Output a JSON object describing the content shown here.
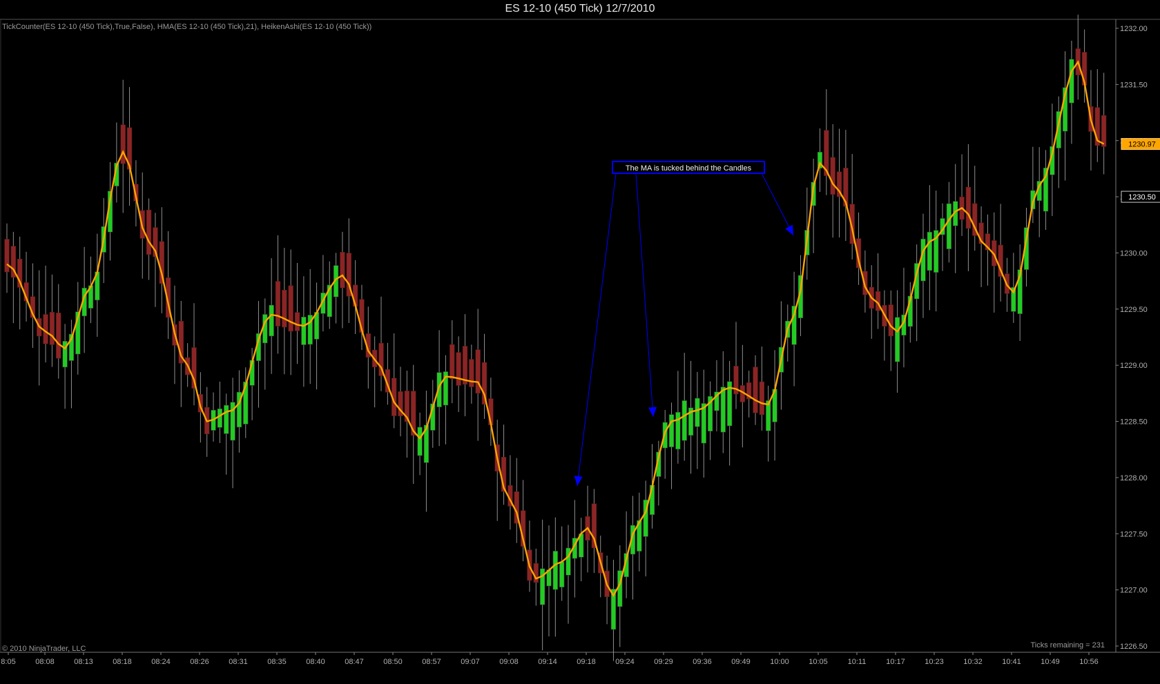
{
  "window": {
    "title": "ES 12-10 (450 Tick)  12/7/2010"
  },
  "chart": {
    "indicator_label": "TickCounter(ES 12-10 (450 Tick),True,False), HMA(ES 12-10 (450 Tick),21), HeikenAshi(ES 12-10 (450 Tick))",
    "copyright": "© 2010 NinjaTrader, LLC",
    "ticks_remaining": "Ticks remaining = 231",
    "annotation": "The MA is tucked behind the Candles",
    "price_markers": {
      "hma_value": "1230.97",
      "last_price": "1230.50"
    },
    "colors": {
      "up_candle": "#22cc22",
      "down_candle": "#8b2525",
      "hma": "#ffa500",
      "annotation_border": "#0000ff",
      "arrow": "#0000ff",
      "wick": "#909090"
    }
  },
  "chart_data": {
    "type": "candlestick",
    "instrument": "ES 12-10",
    "bar_type": "450 Tick",
    "date": "12/7/2010",
    "y_ticks": [
      "1232.00",
      "1231.50",
      "1231.00",
      "1230.50",
      "1230.00",
      "1229.50",
      "1229.00",
      "1228.50",
      "1228.00",
      "1227.50",
      "1227.00",
      "1226.50"
    ],
    "y_tick_values": [
      1232.0,
      1231.5,
      1231.0,
      1230.5,
      1230.0,
      1229.5,
      1229.0,
      1228.5,
      1228.0,
      1227.5,
      1227.0,
      1226.5
    ],
    "x_ticks": [
      "8:05",
      "08:08",
      "08:13",
      "08:18",
      "08:24",
      "08:26",
      "08:31",
      "08:35",
      "08:40",
      "08:47",
      "08:50",
      "08:57",
      "09:07",
      "09:08",
      "09:14",
      "09:18",
      "09:24",
      "09:29",
      "09:36",
      "09:49",
      "10:00",
      "10:05",
      "10:11",
      "10:17",
      "10:23",
      "10:32",
      "10:41",
      "10:49",
      "10:56"
    ],
    "ylim": [
      1226.5,
      1232.0
    ],
    "bars": 171,
    "hma_period": 21,
    "hma_anchors": [
      [
        0,
        1229.9
      ],
      [
        6,
        1229.3
      ],
      [
        9,
        1229.15
      ],
      [
        13,
        1229.7
      ],
      [
        18,
        1230.9
      ],
      [
        22,
        1230.1
      ],
      [
        28,
        1229.0
      ],
      [
        31,
        1228.5
      ],
      [
        35,
        1228.6
      ],
      [
        41,
        1229.45
      ],
      [
        46,
        1229.35
      ],
      [
        52,
        1229.8
      ],
      [
        57,
        1229.05
      ],
      [
        61,
        1228.6
      ],
      [
        64,
        1228.35
      ],
      [
        68,
        1228.9
      ],
      [
        73,
        1228.85
      ],
      [
        78,
        1227.8
      ],
      [
        82,
        1227.1
      ],
      [
        86,
        1227.25
      ],
      [
        90,
        1227.55
      ],
      [
        94,
        1226.95
      ],
      [
        98,
        1227.6
      ],
      [
        103,
        1228.5
      ],
      [
        107,
        1228.6
      ],
      [
        112,
        1228.8
      ],
      [
        118,
        1228.65
      ],
      [
        122,
        1229.45
      ],
      [
        126,
        1230.8
      ],
      [
        129,
        1230.55
      ],
      [
        134,
        1229.6
      ],
      [
        138,
        1229.3
      ],
      [
        143,
        1230.1
      ],
      [
        148,
        1230.4
      ],
      [
        152,
        1230.05
      ],
      [
        156,
        1229.65
      ],
      [
        160,
        1230.6
      ],
      [
        166,
        1231.7
      ],
      [
        169,
        1231.0
      ],
      [
        170,
        1230.97
      ]
    ]
  }
}
